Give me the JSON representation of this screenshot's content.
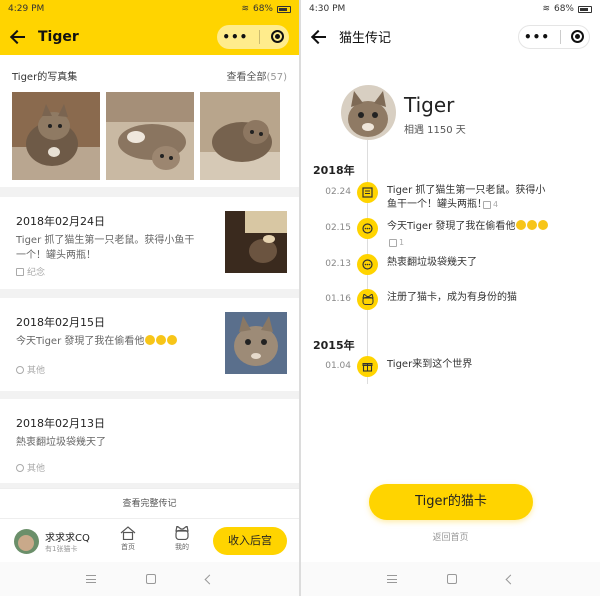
{
  "left": {
    "status": {
      "time": "4:29 PM",
      "battery": "68%"
    },
    "header": {
      "title": "Tiger"
    },
    "album": {
      "title": "Tiger的写真集",
      "view_all": "查看全部",
      "count": "(57)"
    },
    "cards": [
      {
        "date": "2018年02月24日",
        "text": "Tiger 抓了猫生第一只老鼠。获得小鱼干一个！罐头两瓶！",
        "tag": "纪念",
        "has_photo": true
      },
      {
        "date": "2018年02月15日",
        "text": "今天Tiger 發現了我在偷看他",
        "tag": "其他",
        "has_photo": true
      },
      {
        "date": "2018年02月13日",
        "text": "熱衷翻垃圾袋幾天了",
        "tag": "其他",
        "has_photo": false
      }
    ],
    "full_bio_link": "查看完整传记",
    "bottom": {
      "user_name": "求求求CQ",
      "user_sub": "有1张猫卡",
      "tab_home": "首页",
      "tab_mine": "我的",
      "palace_button": "收入后宫"
    }
  },
  "right": {
    "status": {
      "time": "4:30 PM",
      "battery": "68%"
    },
    "header": {
      "title": "猫生传记"
    },
    "profile": {
      "name": "Tiger",
      "days": "相遇 1150 天"
    },
    "timeline": [
      {
        "year": "2018年"
      },
      {
        "date": "02.24",
        "icon": "book-icon",
        "text": "Tiger 抓了猫生第一只老鼠。获得小鱼干一个！罐头两瓶！",
        "meta": "4"
      },
      {
        "date": "02.15",
        "icon": "chat-dots-icon",
        "text": "今天Tiger 發現了我在偷看他",
        "meta": "1"
      },
      {
        "date": "02.13",
        "icon": "chat-dots-icon",
        "text": "熱衷翻垃圾袋幾天了"
      },
      {
        "date": "01.16",
        "icon": "cat-face-icon",
        "text": "注册了猫卡，成为有身份的猫"
      },
      {
        "year": "2015年"
      },
      {
        "date": "01.04",
        "icon": "gift-icon",
        "text": "Tiger来到这个世界"
      }
    ],
    "catcard_button": "Tiger的猫卡",
    "back_home": "返回首页"
  },
  "colors": {
    "accent": "#ffd400",
    "background": "#f2f2f2"
  }
}
